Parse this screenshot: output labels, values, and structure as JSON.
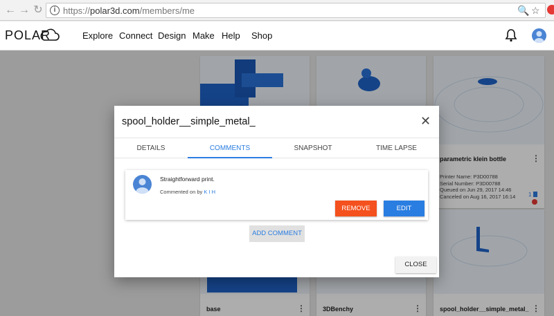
{
  "browser": {
    "url_protocol": "https://",
    "url_domain": "polar3d.com",
    "url_path": "/members/me",
    "back_icon": "arrow-left-icon",
    "forward_icon": "arrow-right-icon",
    "refresh_icon": "refresh-icon"
  },
  "header": {
    "logo_text": "POLAR",
    "nav": [
      "Explore",
      "Connect",
      "Design",
      "Make",
      "Help",
      "Shop"
    ]
  },
  "cards": [
    {
      "title": "",
      "position": "top-left"
    },
    {
      "title": "",
      "position": "top-middle"
    },
    {
      "title": "parametric klein bottle",
      "printer_name": "Printer Name: P3D00788",
      "serial": "Serial Number: P3D00788",
      "queued": "Queued on Jun 29, 2017 14:46",
      "canceled": "Canceled on Aug 16, 2017 16:14",
      "count": "1"
    },
    {
      "title": "base"
    },
    {
      "title": "3DBenchy"
    },
    {
      "title": "spool_holder__simple_metal_"
    }
  ],
  "dialog": {
    "title": "spool_holder__simple_metal_",
    "tabs": [
      "DETAILS",
      "COMMENTS",
      "SNAPSHOT",
      "TIME LAPSE"
    ],
    "active_tab": "COMMENTS",
    "comment": {
      "text": "Straightforward print.",
      "meta_prefix": "Commented on by",
      "author": "K I H"
    },
    "remove_label": "REMOVE",
    "edit_label": "EDIT",
    "add_comment_label": "ADD COMMENT",
    "close_label": "CLOSE"
  },
  "colors": {
    "accent": "#2a7de1",
    "remove": "#f4511e",
    "model_blue": "#1f63c9"
  }
}
